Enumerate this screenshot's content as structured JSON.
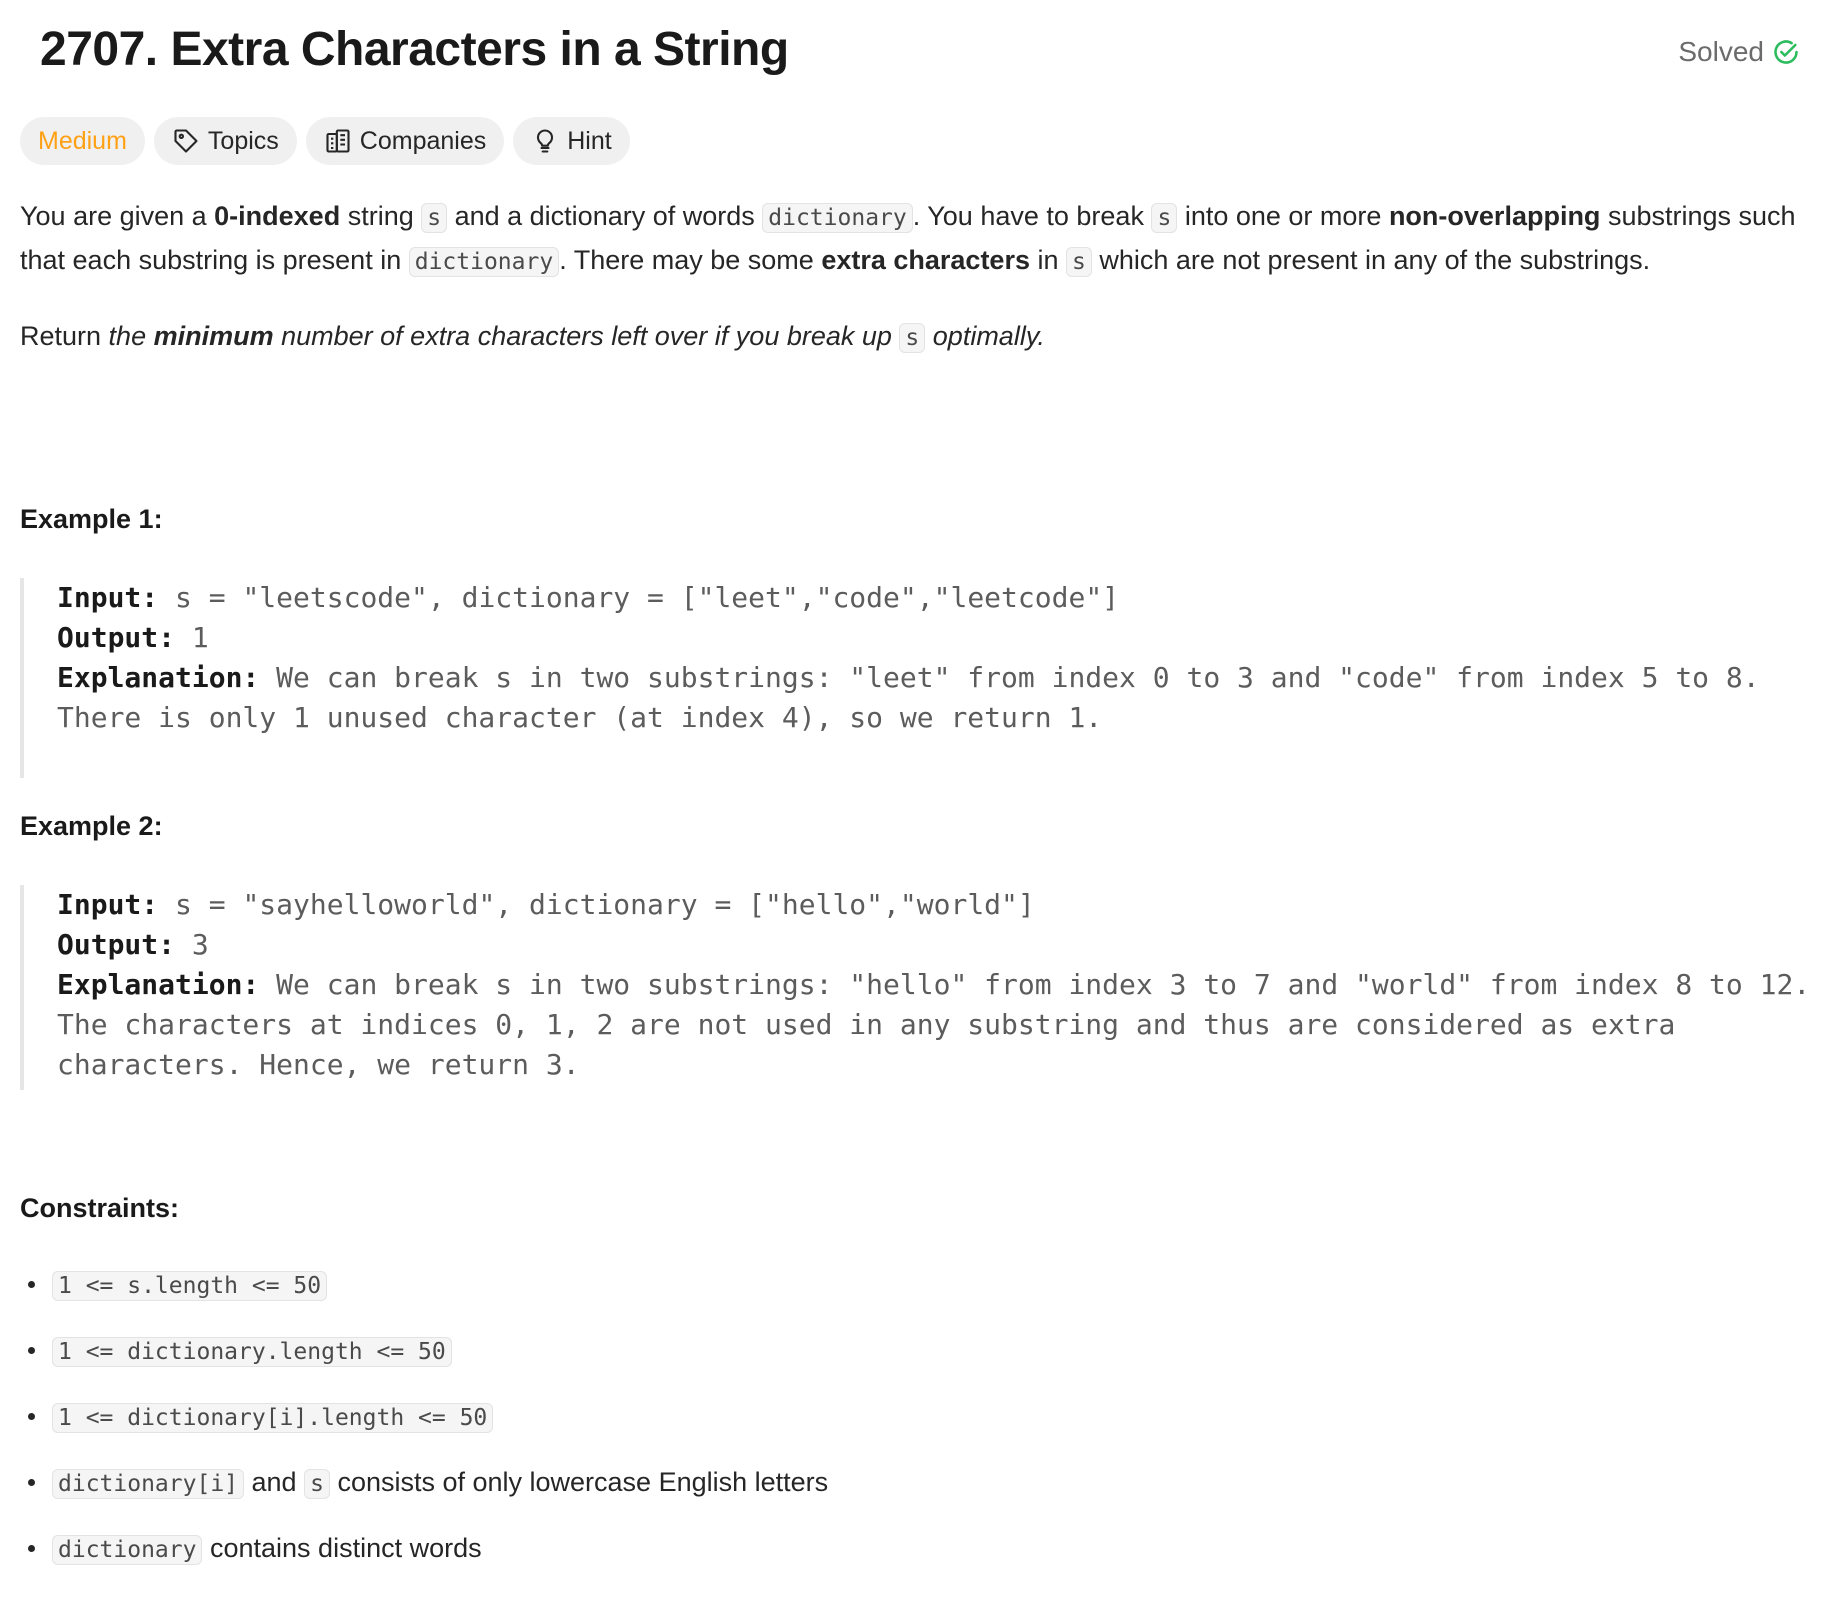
{
  "header": {
    "title": "2707. Extra Characters in a String",
    "status": "Solved"
  },
  "tags": {
    "difficulty": "Medium",
    "topics": "Topics",
    "companies": "Companies",
    "hint": "Hint"
  },
  "description": {
    "p1": {
      "t1": "You are given a ",
      "b1": "0-indexed",
      "t2": " string ",
      "c1": "s",
      "t3": " and a dictionary of words ",
      "c2": "dictionary",
      "t4": ". You have to break ",
      "c3": "s",
      "t5": " into one or more ",
      "b2": "non-overlapping",
      "t6": " substrings such that each substring is present in ",
      "c4": "dictionary",
      "t7": ". There may be some ",
      "b3": "extra characters",
      "t8": " in ",
      "c5": "s",
      "t9": " which are not present in any of the substrings."
    },
    "p2": {
      "t1": "Return ",
      "i1": "the ",
      "b1": "minimum",
      "i2": " number of extra characters left over if you break up ",
      "c1": "s",
      "i3": " optimally."
    }
  },
  "examples": [
    {
      "title": "Example 1:",
      "input_label": "Input:",
      "input": " s = \"leetscode\", dictionary = [\"leet\",\"code\",\"leetcode\"]",
      "output_label": "Output:",
      "output": " 1",
      "explanation_label": "Explanation:",
      "explanation_line1": " We can break s in two substrings: \"leet\" from index 0 to 3 and \"code\" from index 5 to 8.",
      "explanation_line2": "There is only 1 unused character (at index 4), so we return 1."
    },
    {
      "title": "Example 2:",
      "input_label": "Input:",
      "input": " s = \"sayhelloworld\", dictionary = [\"hello\",\"world\"]",
      "output_label": "Output:",
      "output": " 3",
      "explanation_label": "Explanation:",
      "explanation_line1": " We can break s in two substrings: \"hello\" from index 3 to 7 and \"world\" from index 8 to 12.",
      "explanation_line2": "The characters at indices 0, 1, 2 are not used in any substring and thus are considered as extra",
      "explanation_line3": "characters. Hence, we return 3."
    }
  ],
  "constraints": {
    "title": "Constraints:",
    "c1": "1 <= s.length <= 50",
    "c2": "1 <= dictionary.length <= 50",
    "c3": "1 <= dictionary[i].length <= 50",
    "c4_code1": "dictionary[i]",
    "c4_text1": " and ",
    "c4_code2": "s",
    "c4_text2": " consists of only lowercase English letters",
    "c5_code": "dictionary",
    "c5_text": " contains distinct words"
  },
  "colors": {
    "medium": "#ffa116",
    "solved_check": "#2cbb5d"
  }
}
